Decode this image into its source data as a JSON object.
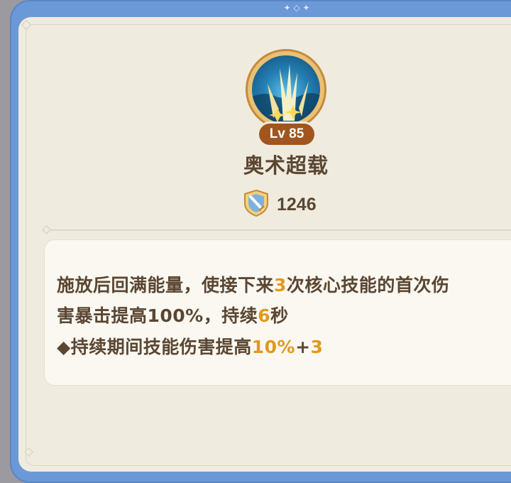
{
  "frame": {
    "ornament": "✦ ◇ ✦"
  },
  "skill": {
    "icon": "arcane-overload-icon",
    "level": "Lv 85",
    "name": "奥术超载",
    "power_icon": "shield-sword-icon",
    "power": "1246"
  },
  "description": {
    "line1": [
      {
        "text": "施放后回满能量，使接下来",
        "hl": false
      },
      {
        "text": "3",
        "hl": true
      },
      {
        "text": "次核心技能的首次伤",
        "hl": false
      }
    ],
    "line2": [
      {
        "text": "害暴击提高100%，持续",
        "hl": false
      },
      {
        "text": "6",
        "hl": true
      },
      {
        "text": "秒",
        "hl": false
      }
    ],
    "line3": [
      {
        "text": "◆持续期间技能伤害提高",
        "hl": false
      },
      {
        "text": "10%",
        "hl": true
      },
      {
        "text": "+",
        "hl": false
      },
      {
        "text": "3",
        "hl": true
      }
    ]
  },
  "colors": {
    "frame": "#6b98d6",
    "panel": "#f0ebdf",
    "text": "#5a4632",
    "highlight": "#e09a1f",
    "level_badge": "#a0561e"
  }
}
